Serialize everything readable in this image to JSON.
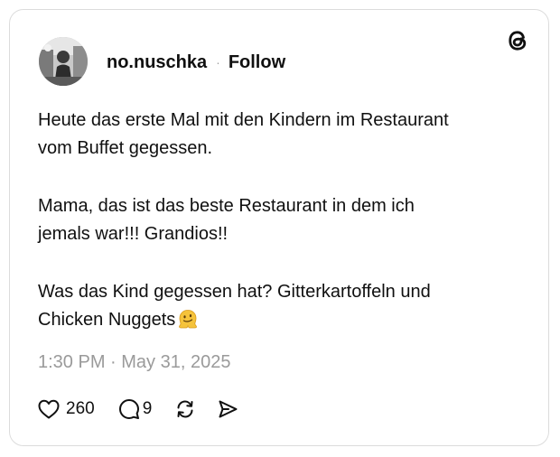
{
  "post": {
    "username": "no.nuschka",
    "separator": "·",
    "follow_label": "Follow",
    "paragraphs": [
      {
        "line1": "Heute das erste Mal mit den Kindern im Restaurant",
        "line2": "vom Buffet gegessen."
      },
      {
        "line1": "Mama, das ist das beste Restaurant in dem ich",
        "line2": "jemals war!!! Grandios!!"
      },
      {
        "line1": "Was das Kind gegessen hat? Gitterkartoffeln und",
        "line2": "Chicken Nuggets"
      }
    ],
    "emoji": "melting-face-emoji",
    "timestamp": "1:30 PM · May 31, 2025",
    "likes": "260",
    "replies": "9"
  },
  "icons": {
    "brand": "threads-logo-icon",
    "like": "heart-icon",
    "reply": "comment-icon",
    "repost": "repost-icon",
    "share": "send-icon"
  },
  "colors": {
    "text": "#101010",
    "muted": "#9a9a9a",
    "border": "#dcdcdc",
    "emoji": "#f5c33b"
  }
}
